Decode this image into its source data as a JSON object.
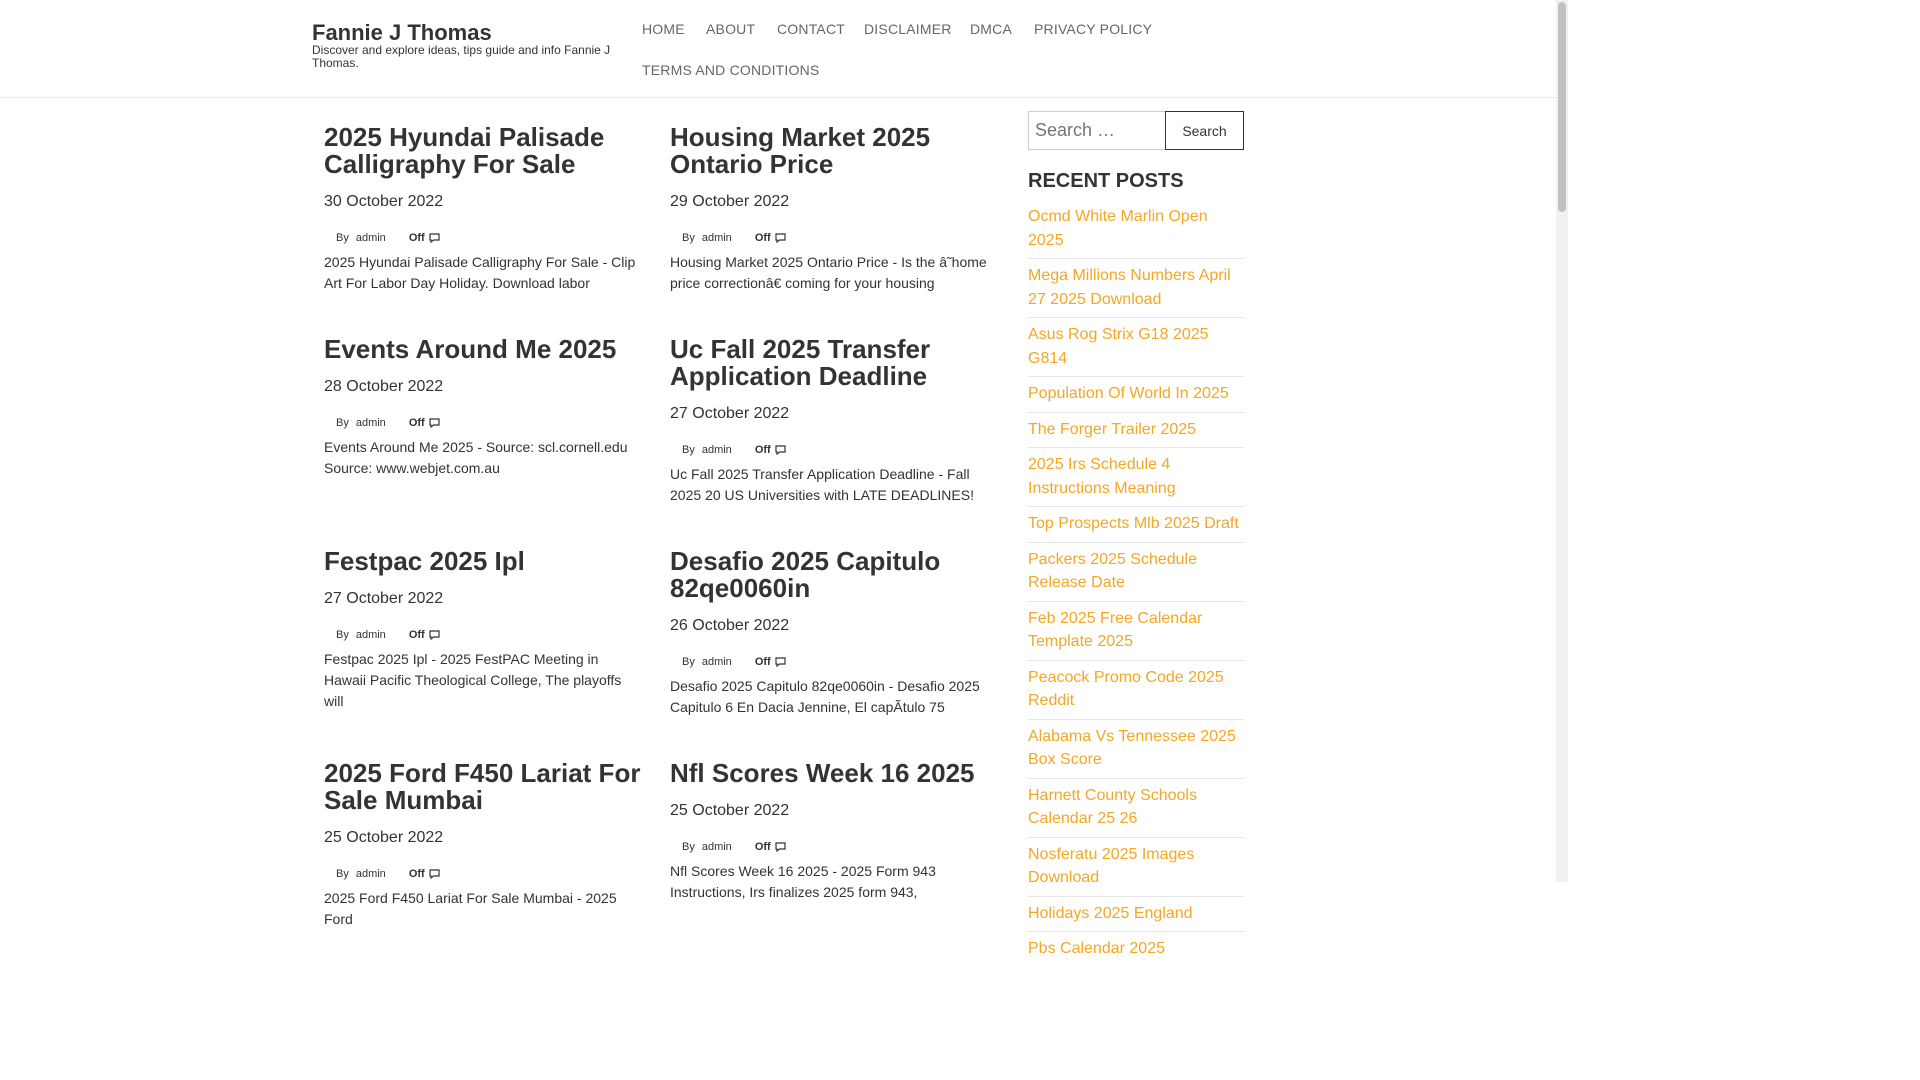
{
  "site": {
    "title": "Fannie J Thomas",
    "description": "Discover and explore ideas, tips guide and info Fannie J Thomas."
  },
  "nav": [
    "HOME",
    "ABOUT",
    "CONTACT",
    "DISCLAIMER",
    "DMCA",
    "PRIVACY POLICY",
    "TERMS AND CONDITIONS"
  ],
  "posts": [
    {
      "title": "2025 Hyundai Palisade Calligraphy For Sale",
      "date": "30 October 2022",
      "by": "By",
      "author": "admin",
      "comments": "Off",
      "comment_icon": "comment-icon",
      "excerpt": "2025 Hyundai Palisade Calligraphy For Sale - Clip Art For Labor Day Holiday. Download labor"
    },
    {
      "title": "Housing Market 2025 Ontario Price",
      "date": "29 October 2022",
      "by": "By",
      "author": "admin",
      "comments": "Off",
      "comment_icon": "comment-icon",
      "excerpt": "Housing Market 2025 Ontario Price - Is the â˜home price correctionâ€ coming for your housing"
    },
    {
      "title": "Events Around Me 2025",
      "date": "28 October 2022",
      "by": "By",
      "author": "admin",
      "comments": "Off",
      "comment_icon": "comment-icon",
      "excerpt": "Events Around Me 2025 - Source: scl.cornell.edu Source: www.webjet.com.au"
    },
    {
      "title": "Uc Fall 2025 Transfer Application Deadline",
      "date": "27 October 2022",
      "by": "By",
      "author": "admin",
      "comments": "Off",
      "comment_icon": "comment-icon",
      "excerpt": "Uc Fall 2025 Transfer Application Deadline - Fall 2025 20 US Universities with LATE DEADLINES!"
    },
    {
      "title": "Festpac 2025 Ipl",
      "date": "27 October 2022",
      "by": "By",
      "author": "admin",
      "comments": "Off",
      "comment_icon": "comment-icon",
      "excerpt": "Festpac 2025 Ipl - 2025 FestPAC Meeting in Hawaii Pacific Theological College, The playoffs will"
    },
    {
      "title": "Desafio 2025 Capitulo 82qe0060in",
      "date": "26 October 2022",
      "by": "By",
      "author": "admin",
      "comments": "Off",
      "comment_icon": "comment-icon",
      "excerpt": "Desafio 2025 Capitulo 82qe0060in - Desafio 2025 Capitulo 6 En Dacia Jennine, El capÃtulo 75"
    },
    {
      "title": "2025 Ford F450 Lariat For Sale Mumbai",
      "date": "25 October 2022",
      "by": "By",
      "author": "admin",
      "comments": "Off",
      "comment_icon": "comment-icon",
      "excerpt": "2025 Ford F450 Lariat For Sale Mumbai - 2025 Ford"
    },
    {
      "title": "Nfl Scores Week 16 2025",
      "date": "25 October 2022",
      "by": "By",
      "author": "admin",
      "comments": "Off",
      "comment_icon": "comment-icon",
      "excerpt": "Nfl Scores Week 16 2025 - 2025 Form 943 Instructions, Irs finalizes 2025 form 943,"
    }
  ],
  "sidebar": {
    "search_placeholder": "Search …",
    "search_button": "Search",
    "recent_title": "RECENT POSTS",
    "recent_posts": [
      "Ocmd White Marlin Open 2025",
      "Mega Millions Numbers April 27 2025 Download",
      "Asus Rog Strix G18 2025 G814",
      "Population Of World In 2025",
      "The Forger Trailer 2025",
      "2025 Irs Schedule 4 Instructions Meaning",
      "Top Prospects Mlb 2025 Draft",
      "Packers 2025 Schedule Release Date",
      "Feb 2025 Free Calendar Template 2025",
      "Peacock Promo Code 2025 Reddit",
      "Alabama Vs Tennessee 2025 Box Score",
      "Harnett County Schools Calendar 25 26",
      "Nosferatu 2025 Images Download",
      "Holidays 2025 England",
      "Pbs Calendar 2025"
    ]
  },
  "colors": {
    "link": "#f5a623",
    "text": "#333333",
    "nav": "#666666"
  }
}
